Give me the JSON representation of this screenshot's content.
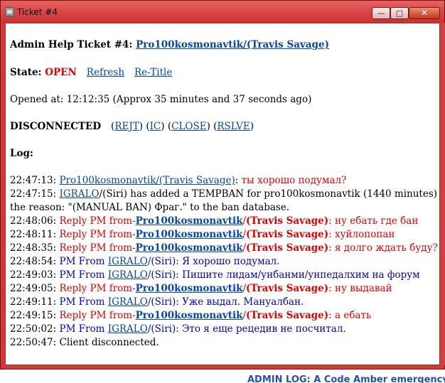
{
  "window": {
    "title": "Ticket #4",
    "minimize": "—",
    "maximize": "□",
    "close": "✕"
  },
  "ticket": {
    "header_prefix": "Admin Help Ticket #4: ",
    "player_link": "Pro100kosmonavtik/(Travis Savage)",
    "state_label": "State: ",
    "state_value": "OPEN",
    "refresh": "Refresh",
    "retitle": "Re-Title",
    "opened": "Opened at: 12:12:35 (Approx 35 minutes and 37 seconds ago)",
    "connection": "DISCONNECTED",
    "actions": {
      "open_paren1": "(",
      "rejt": "REJT",
      "mid1": ") (",
      "ic": "IC",
      "mid2": ") (",
      "close": "CLOSE",
      "mid3": ") (",
      "rslve": "RSLVE",
      "end": ")"
    },
    "log_label": "Log:"
  },
  "log": {
    "l1": {
      "time": "22:47:13: ",
      "link": "Pro100kosmonavtik/(Travis Savage)",
      "sep": ": ",
      "msg": "ты хорошо подумал?"
    },
    "l2a": {
      "time": "22:47:15: ",
      "link": "IGRALO",
      "rest": "/(Siri) has added a TEMPBAN for pro100kosmonavtik (1440 minutes) with"
    },
    "l2b": {
      "text": "the reason: \"(MANUAL BAN) Фраг.\" to the ban database."
    },
    "l3": {
      "time": "22:48:06: ",
      "prefix": "Reply PM from-",
      "link": "Pro100kosmonavtik",
      "slash": "/",
      "name": "(Travis Savage)",
      "sep": ": ",
      "msg": "ну ебать где бан"
    },
    "l4": {
      "time": "22:48:11: ",
      "prefix": "Reply PM from-",
      "link": "Pro100kosmonavtik",
      "slash": "/",
      "name": "(Travis Savage)",
      "sep": ": ",
      "msg": "хуйлопопан"
    },
    "l5": {
      "time": "22:48:35: ",
      "prefix": "Reply PM from-",
      "link": "Pro100kosmonavtik",
      "slash": "/",
      "name": "(Travis Savage)",
      "sep": ": ",
      "msg": "я долго ждать буду?"
    },
    "l6": {
      "time": "22:48:54: ",
      "prefix": "PM From ",
      "link": "IGRALO",
      "rest": "/(Siri): Я хорошо подумал."
    },
    "l7": {
      "time": "22:49:03: ",
      "prefix": "PM From ",
      "link": "IGRALO",
      "rest": "/(Siri): Пишите лидам/унбанми/унпедалхим на форум"
    },
    "l8": {
      "time": "22:49:05: ",
      "prefix": "Reply PM from-",
      "link": "Pro100kosmonavtik",
      "slash": "/",
      "name": "(Travis Savage)",
      "sep": ": ",
      "msg": "ну выдавай"
    },
    "l9": {
      "time": "22:49:11: ",
      "prefix": "PM From ",
      "link": "IGRALO",
      "rest": "/(Siri): Уже выдал. Мануалбан."
    },
    "l10": {
      "time": "22:49:15: ",
      "prefix": "Reply PM from-",
      "link": "Pro100kosmonavtik",
      "slash": "/",
      "name": "(Travis Savage)",
      "sep": ": ",
      "msg": "а ебать"
    },
    "l11": {
      "time": "22:50:02: ",
      "prefix": "PM From ",
      "link": "IGRALO",
      "rest": "/(Siri): Это я еще рецедив не посчитал."
    },
    "l12": {
      "time": "22:50:47: ",
      "text": "Client disconnected."
    }
  },
  "background": {
    "text": "ADMIN LOG: A Code Amber emergency"
  },
  "colors": {
    "window_frame": "#cf3a3a",
    "link": "#0645ad",
    "state_open": "#e00000",
    "reply_pm": "#e00000",
    "pm_from": "#0000cc"
  }
}
